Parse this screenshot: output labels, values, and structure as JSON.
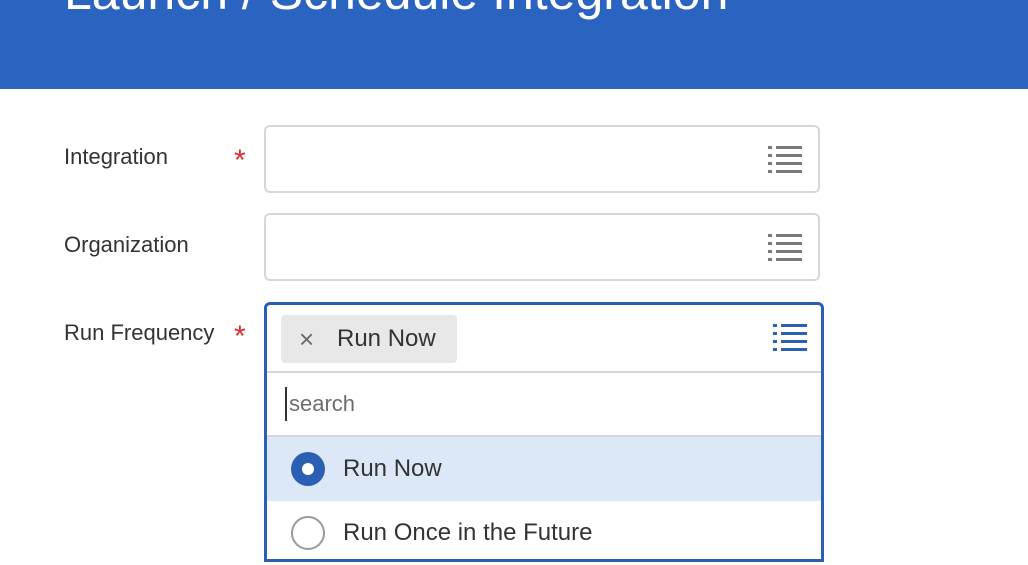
{
  "header": {
    "title": "Launch / Schedule Integration"
  },
  "form": {
    "integration": {
      "label": "Integration",
      "required_mark": "*",
      "icon": "list-icon"
    },
    "organization": {
      "label": "Organization",
      "icon": "list-icon"
    },
    "run_frequency": {
      "label": "Run Frequency",
      "required_mark": "*",
      "selected_pill": {
        "remove_glyph": "×",
        "text": "Run Now"
      },
      "icon": "list-icon",
      "search": {
        "placeholder": "search",
        "value": ""
      },
      "options": [
        {
          "label": "Run Now",
          "selected": true
        },
        {
          "label": "Run Once in the Future",
          "selected": false
        }
      ]
    }
  },
  "colors": {
    "header_bg": "#2b63c0",
    "accent": "#2b5fb3",
    "required": "#de2e2e",
    "selected_option_bg": "#dce8f8"
  }
}
